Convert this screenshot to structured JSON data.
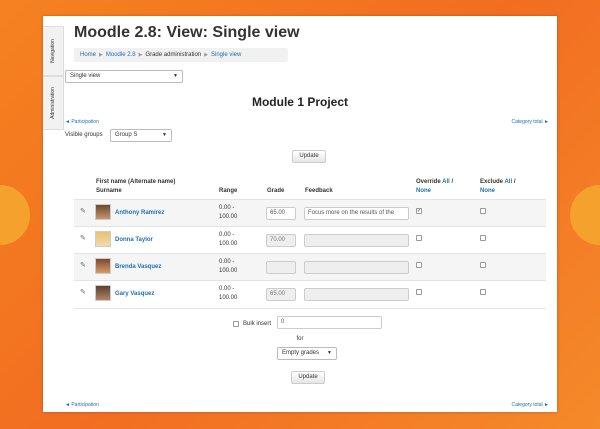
{
  "dock": {
    "navigation_label": "Navigation",
    "administration_label": "Administration"
  },
  "header": {
    "title": "Moodle 2.8: View: Single view",
    "breadcrumb": [
      "Home",
      "Moodle 2.8",
      "Grade administration",
      "Single view"
    ]
  },
  "view_select": {
    "value": "Single view"
  },
  "heading": "Module 1 Project",
  "nav": {
    "participation": "◄ Participation",
    "category_total": "Category total ►"
  },
  "groups": {
    "label": "Visible groups",
    "value": "Group S"
  },
  "buttons": {
    "update": "Update"
  },
  "table": {
    "headers": {
      "name_line1": "First name (Alternate name)",
      "name_line2": "Surname",
      "range": "Range",
      "grade": "Grade",
      "feedback": "Feedback",
      "override": "Override",
      "exclude": "Exclude",
      "all": "All",
      "none": "None",
      "slash": "/"
    },
    "rows": [
      {
        "name": "Anthony Ramirez",
        "range_from": "0.00 -",
        "range_to": "100.00",
        "grade": "65.00",
        "feedback": "Focus more on the results of the",
        "override": true,
        "exclude": false
      },
      {
        "name": "Donna Taylor",
        "range_from": "0.00 -",
        "range_to": "100.00",
        "grade": "70.00",
        "feedback": "",
        "override": false,
        "exclude": false
      },
      {
        "name": "Brenda Vasquez",
        "range_from": "0.00 -",
        "range_to": "100.00",
        "grade": "",
        "feedback": "",
        "override": false,
        "exclude": false
      },
      {
        "name": "Gary Vasquez",
        "range_from": "0.00 -",
        "range_to": "100.00",
        "grade": "65.00",
        "feedback": "",
        "override": false,
        "exclude": false
      }
    ]
  },
  "bulk": {
    "label": "Bulk insert",
    "value": "0",
    "for_label": "for",
    "for_value": "Empty grades"
  },
  "colors": {
    "accent": "#f58220",
    "link": "#1f6fb2"
  }
}
